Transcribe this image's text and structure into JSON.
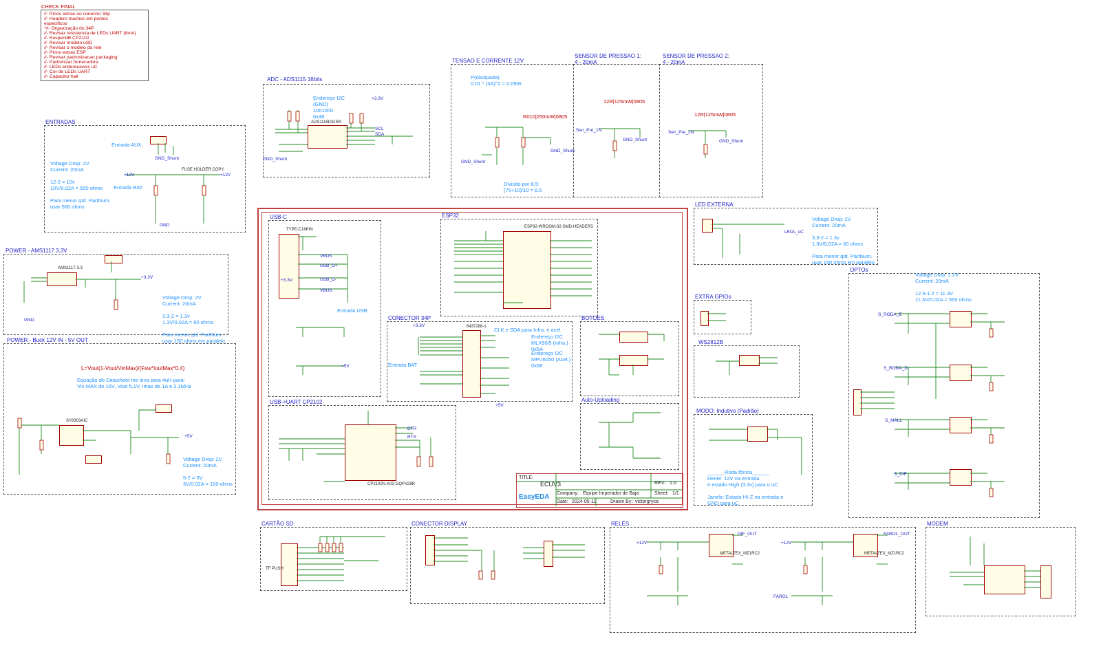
{
  "check_final": {
    "title": "CHECK FINAL",
    "items": [
      "//- Pinos extras no conector 34p",
      "//- Headers machos em pontos",
      "especificos",
      "*//- Organização do 34P",
      "//- Revisar resistencia de LEDs UART (8mA)",
      "//- SuspendB CP2102",
      "//- Revisar modelo uSD",
      "//- Revisar o modelo do relé",
      "//- Pinos extras ESP",
      "//- Revisar padronizacao packaging",
      "//- Padronizar fornecedora",
      "//- LEDs enderecaveis uC",
      "//- Cor de LEDs UART",
      "//- Capacitor hall"
    ]
  },
  "blocks": {
    "adc": {
      "title": "ADC - ADS1115 16bits",
      "note": "Endereço I2C\n(GND)\n1001000\n0x48",
      "part": "ADS1115IDGSR",
      "ref": "U5"
    },
    "tensao": {
      "title": "TENSAO E CORRENTE 12V",
      "note1": "P(dissipada):\n0.01 * (3A)^2 = 0.09W",
      "res": "R010|250mW|0805",
      "note2": "Divisão por 8.5:\n(75+10)/10 = 8.5"
    },
    "sp1": {
      "title": "SENSOR DE PRESSAO 1:\n4 - 20mA",
      "res": "12R|125mW|0805"
    },
    "sp2": {
      "title": "SENSOR DE PRESSAO 2:\n4 - 20mA",
      "res": "12R|125mW|0805"
    },
    "entradas": {
      "title": "ENTRADAS",
      "aux": "Entrada AUX",
      "bat": "Entrada BAT",
      "note": "Voltage Drop: 2V\nCurrent: 20mA\n\n12-2 = 10v\n10V/0.02A = 500 ohms\n\nPara menor qtd. PartNum.\nusar 560 ohms",
      "fuse": "FUSE HOLDER COPY"
    },
    "ams": {
      "title": "POWER - AMS1117 3.3V",
      "note": "Voltage Drop: 2V\nCurrent: 20mA\n\n3.3-2 = 1.3v\n1.3V/0.02A = 60 ohms\n\nPara menor qtd. PartNum.\nusar 150 ohms em paralelo",
      "part": "AMS1117-3.3"
    },
    "buck": {
      "title": "POWER - Buck 12V IN - 5V OUT",
      "formula": "L=Vout(1-Vout/VinMax)/(Fsw*IoutMax*0.4)",
      "note": "Equação do Datasheet me leva para 4uH para:\nVin MAX de 15V, Vout 5,1V, Imax de 1A e 2,1MHz",
      "note2": "Voltage Drop: 2V\nCurrent: 20mA\n\n5-2 = 3V\n3V/0.02A = 150 ohms",
      "part": "SY8303AIC"
    },
    "usbc": {
      "title": "USB-C",
      "part": "TYPE-C16PIN",
      "note": "Entrada USB"
    },
    "esp32": {
      "title": "ESP32",
      "part": "ESP32-WROOM-32-SMD-HEADERS"
    },
    "conector": {
      "title": "CONECTOR 34P",
      "note1": "CLK e SDA para Infra. e acel.",
      "note2": "Endereço I2C\nMLX90i5 (Infra.)\n0x5A",
      "note3": "Endereço I2C\nMPU6050 (Acel.)\n0x68",
      "bat": "Entrada BAT",
      "part": "6437288-1"
    },
    "botoes": {
      "title": "BOTOES"
    },
    "auto": {
      "title": "Auto-Uploading"
    },
    "uart": {
      "title": "USB->UART CP2102",
      "part": "CP2102N-A02-GQFN28R"
    },
    "led_ext": {
      "title": "LED EXTERNA",
      "note": "Voltage Drop: 2V\nCurrent: 20mA\n\n3.3-2 = 1.3v\n1.3V/0.02A = 60 ohms\n\nPara menor qtd. PartNum.\nusar 150 ohms em paralelo"
    },
    "gpios": {
      "title": "EXTRA GPIOs"
    },
    "ws": {
      "title": "WS2812B"
    },
    "modo": {
      "title": "MODO: Indutivo (Padrão)",
      "note": "______Roda fônica______\nDente: 12V na entrada\ne estado High (3.3v) para o uC\n\nJanela: Estado HI-Z na entrada e\nGND para uC"
    },
    "optos": {
      "title": "OPTOs",
      "note": "Voltage Drop: 1.2V\nCurrent: 20mA\n\n12.5-1.2 = 11.3V\n11.3V/0.02A = 565 ohms"
    },
    "cartao": {
      "title": "CARTÃO SD",
      "part": "TF PUSH"
    },
    "display": {
      "title": "CONECTOR DISPLAY"
    },
    "reles": {
      "title": "RELÉS",
      "part": "METALTEX_MZ1RC2"
    },
    "modem": {
      "title": "MODEM"
    }
  },
  "title_block": {
    "title_label": "TITLE:",
    "title": "ECUV3",
    "rev_label": "REV:",
    "rev": "1.0",
    "company_label": "Company:",
    "company": "Equipe Imperador de Baja",
    "sheet_label": "Sheet:",
    "sheet": "1/1",
    "date_label": "Date:",
    "date": "2024-05-11",
    "drawn_label": "Drawn By:",
    "drawn": "victorgryca",
    "logo": "EasyEDA"
  },
  "nets": [
    "+3.3V",
    "+5V",
    "+12V",
    "GND",
    "GND_Shunt",
    "SCL",
    "SDA",
    "VBUS",
    "USB_D+",
    "USB_D-",
    "DTR",
    "RTS",
    "S_RODA_E",
    "S_RODA_D",
    "S_MALL",
    "S_DIF",
    "FAROL",
    "LEDs_uC",
    "DIF_OUT",
    "FAROL_OUT",
    "Sen_Pre_1N",
    "Sen_Pre_2N"
  ],
  "colors": {
    "wire": "#1a8a1a",
    "frame": "#c04040",
    "ic_border": "#a00000",
    "ic_fill": "#fffde6",
    "net": "#2020c8",
    "note": "#1e90ff",
    "comment": "#c00000"
  }
}
